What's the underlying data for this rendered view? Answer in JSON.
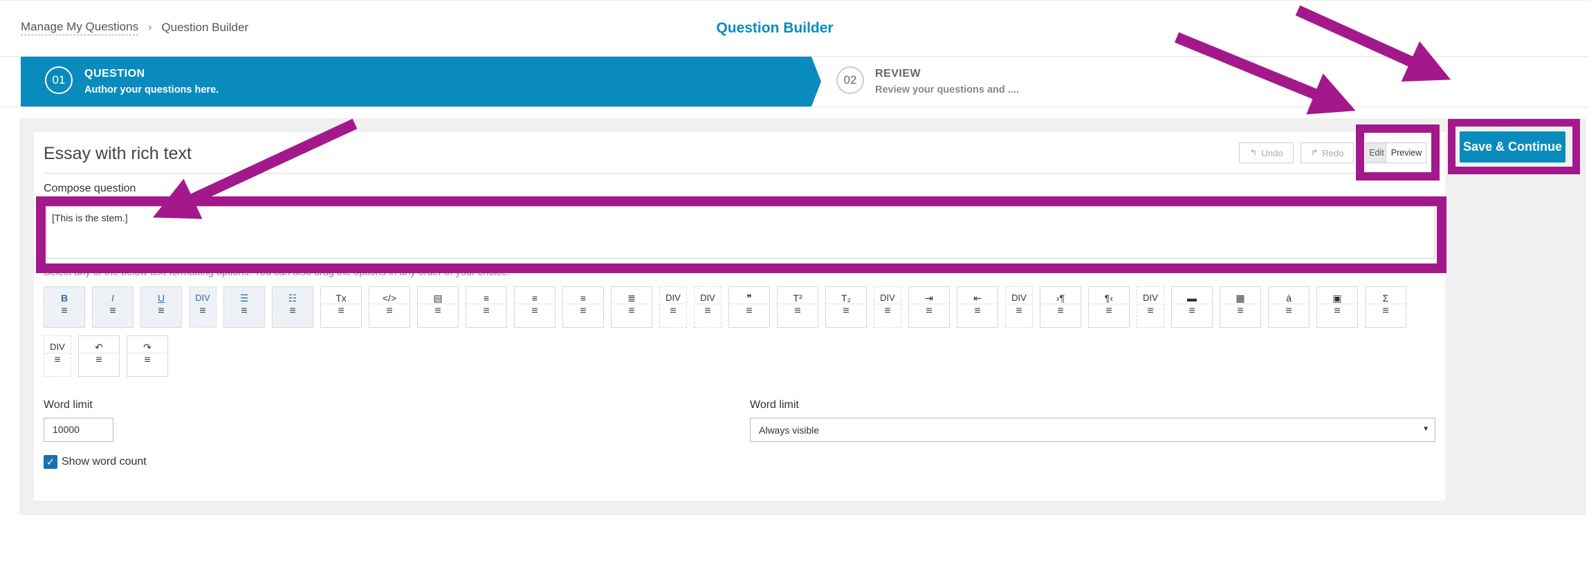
{
  "header": {
    "breadcrumb_root": "Manage My Questions",
    "breadcrumb_current": "Question Builder",
    "title": "Question Builder"
  },
  "stepper": {
    "step1": {
      "number": "01",
      "title": "QUESTION",
      "subtitle": "Author your questions here."
    },
    "step2": {
      "number": "02",
      "title": "REVIEW",
      "subtitle": "Review your questions and ...."
    }
  },
  "editor": {
    "question_type": "Essay with rich text",
    "undo_label": "Undo",
    "redo_label": "Redo",
    "mode_edit": "Edit",
    "mode_preview": "Preview",
    "compose_label": "Compose question",
    "stem_text": "[This is the stem.]",
    "hint_text": "Select any of the below text formatting options. You can also drag the options in any order of your choice."
  },
  "toolbar": {
    "handle_glyph": "≡",
    "tools": [
      {
        "name": "bold",
        "glyph": "B",
        "active": true
      },
      {
        "name": "italic",
        "glyph": "I",
        "active": true
      },
      {
        "name": "underline",
        "glyph": "U",
        "active": true
      },
      {
        "name": "div",
        "glyph": "DIV",
        "active": true,
        "dashed": true
      },
      {
        "name": "bullet-list",
        "glyph": "☰",
        "active": true
      },
      {
        "name": "numbered-list",
        "glyph": "☷",
        "active": true
      },
      {
        "name": "clear-format",
        "glyph": "Tx"
      },
      {
        "name": "code",
        "glyph": "</>"
      },
      {
        "name": "table-simple",
        "glyph": "▤"
      },
      {
        "name": "align-left",
        "glyph": "≡"
      },
      {
        "name": "align-center",
        "glyph": "≡"
      },
      {
        "name": "align-right",
        "glyph": "≡"
      },
      {
        "name": "align-justify",
        "glyph": "≣"
      },
      {
        "name": "div",
        "glyph": "DIV",
        "dashed": true
      },
      {
        "name": "div",
        "glyph": "DIV",
        "dashed": true
      },
      {
        "name": "blockquote",
        "glyph": "❞"
      },
      {
        "name": "superscript",
        "glyph": "T²"
      },
      {
        "name": "subscript",
        "glyph": "T₂"
      },
      {
        "name": "div",
        "glyph": "DIV",
        "dashed": true
      },
      {
        "name": "indent",
        "glyph": "⇥"
      },
      {
        "name": "outdent",
        "glyph": "⇤"
      },
      {
        "name": "div",
        "glyph": "DIV",
        "dashed": true
      },
      {
        "name": "ltr",
        "glyph": "›¶"
      },
      {
        "name": "rtl",
        "glyph": "¶‹"
      },
      {
        "name": "div",
        "glyph": "DIV",
        "dashed": true
      },
      {
        "name": "horizontal-rule",
        "glyph": "▬"
      },
      {
        "name": "table",
        "glyph": "▦"
      },
      {
        "name": "special-char",
        "glyph": "á"
      },
      {
        "name": "image",
        "glyph": "▣"
      },
      {
        "name": "math",
        "glyph": "Σ"
      },
      {
        "name": "div",
        "glyph": "DIV",
        "dashed": true
      },
      {
        "name": "undo",
        "glyph": "↶"
      },
      {
        "name": "redo",
        "glyph": "↷"
      }
    ]
  },
  "settings": {
    "word_limit_label": "Word limit",
    "word_limit_value": "10000",
    "visibility_label": "Word limit",
    "visibility_value": "Always visible",
    "show_word_count_label": "Show word count",
    "show_word_count_checked": true
  },
  "actions": {
    "save_label": "Save & Continue"
  },
  "colors": {
    "accent": "#0a8bbd",
    "annotation": "#a3198c"
  }
}
